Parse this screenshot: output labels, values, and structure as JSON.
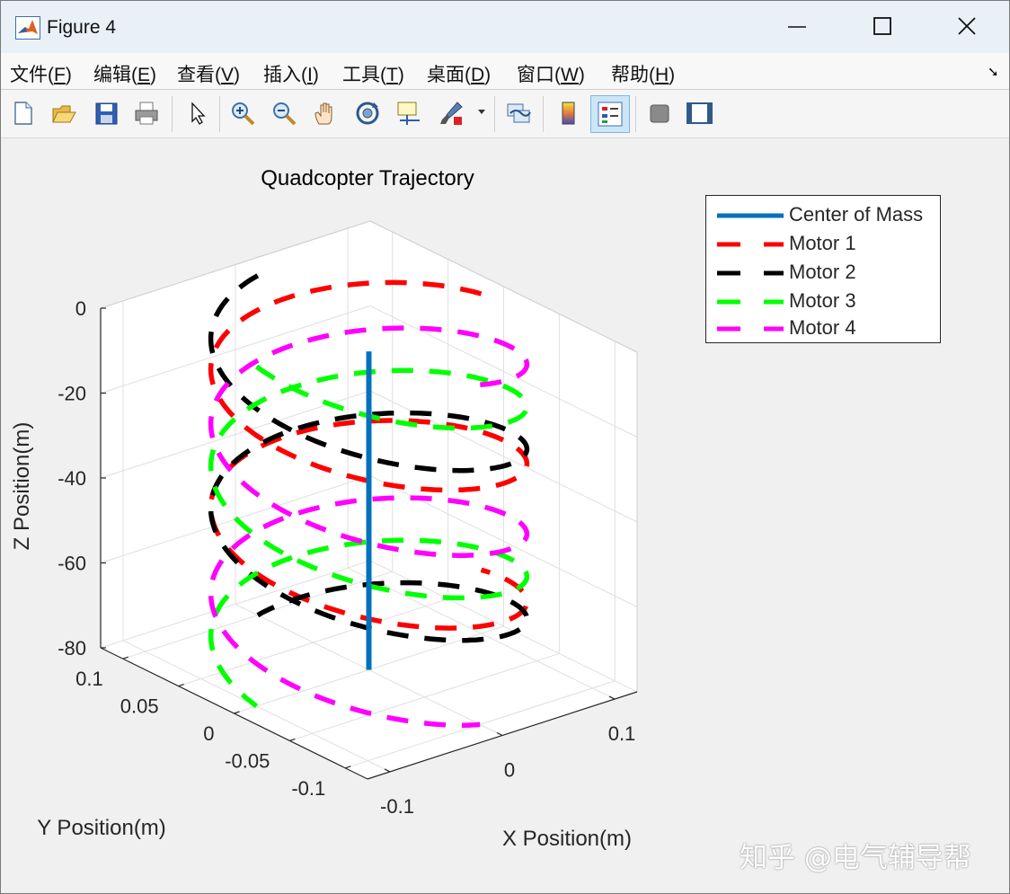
{
  "window": {
    "title": "Figure 4",
    "app_icon": "matlab-icon"
  },
  "menu": [
    {
      "label": "文件(",
      "key": "F",
      "close": ")"
    },
    {
      "label": "编辑(",
      "key": "E",
      "close": ")"
    },
    {
      "label": "查看(",
      "key": "V",
      "close": ")"
    },
    {
      "label": "插入(",
      "key": "I",
      "close": ")"
    },
    {
      "label": "工具(",
      "key": "T",
      "close": ")"
    },
    {
      "label": "桌面(",
      "key": "D",
      "close": ")"
    },
    {
      "label": "窗口(",
      "key": "W",
      "close": ")"
    },
    {
      "label": "帮助(",
      "key": "H",
      "close": ")"
    }
  ],
  "toolbar": [
    "new-figure-icon",
    "open-file-icon",
    "save-icon",
    "print-icon",
    "select-arrow-icon",
    "zoom-in-icon",
    "zoom-out-icon",
    "pan-hand-icon",
    "rotate-3d-icon",
    "data-cursor-icon",
    "brush-icon",
    "link-plot-icon",
    "colorbar-icon",
    "legend-icon",
    "hide-plot-tools-icon",
    "show-plot-tools-icon"
  ],
  "chart_data": {
    "type": "line",
    "title": "Quadcopter Trajectory",
    "xlabel": "X Position(m)",
    "ylabel": "Y Position(m)",
    "zlabel": "Z Position(m)",
    "xlim": [
      -0.12,
      0.12
    ],
    "ylim": [
      -0.12,
      0.12
    ],
    "zlim": [
      -80,
      0
    ],
    "xticks": [
      "-0.1",
      "0",
      "0.1"
    ],
    "yticks": [
      "-0.1",
      "-0.05",
      "0",
      "0.05",
      "0.1"
    ],
    "zticks": [
      "0",
      "-20",
      "-40",
      "-60",
      "-80"
    ],
    "grid": true,
    "legend_position": "top-right-outside",
    "series": [
      {
        "name": "Center of Mass",
        "color": "#0072BD",
        "style": "solid",
        "points": [
          [
            0,
            0,
            -5
          ],
          [
            0,
            0,
            -80
          ]
        ]
      },
      {
        "name": "Motor 1",
        "color": "#ff0000",
        "style": "dashed",
        "radius": 0.1,
        "phase_deg": 0,
        "turns": 2,
        "z_start": 0,
        "z_end": -65
      },
      {
        "name": "Motor 2",
        "color": "#000000",
        "style": "dashed",
        "radius": 0.1,
        "phase_deg": 90,
        "turns": 2,
        "z_start": 0,
        "z_end": -80
      },
      {
        "name": "Motor 3",
        "color": "#00ff00",
        "style": "dashed",
        "radius": 0.1,
        "phase_deg": 180,
        "turns": 2,
        "z_start": 0,
        "z_end": -80
      },
      {
        "name": "Motor 4",
        "color": "#ff00ff",
        "style": "dashed",
        "radius": 0.1,
        "phase_deg": 270,
        "turns": 2,
        "z_start": 0,
        "z_end": -80
      }
    ]
  },
  "watermark": "知乎 @电气辅导帮"
}
